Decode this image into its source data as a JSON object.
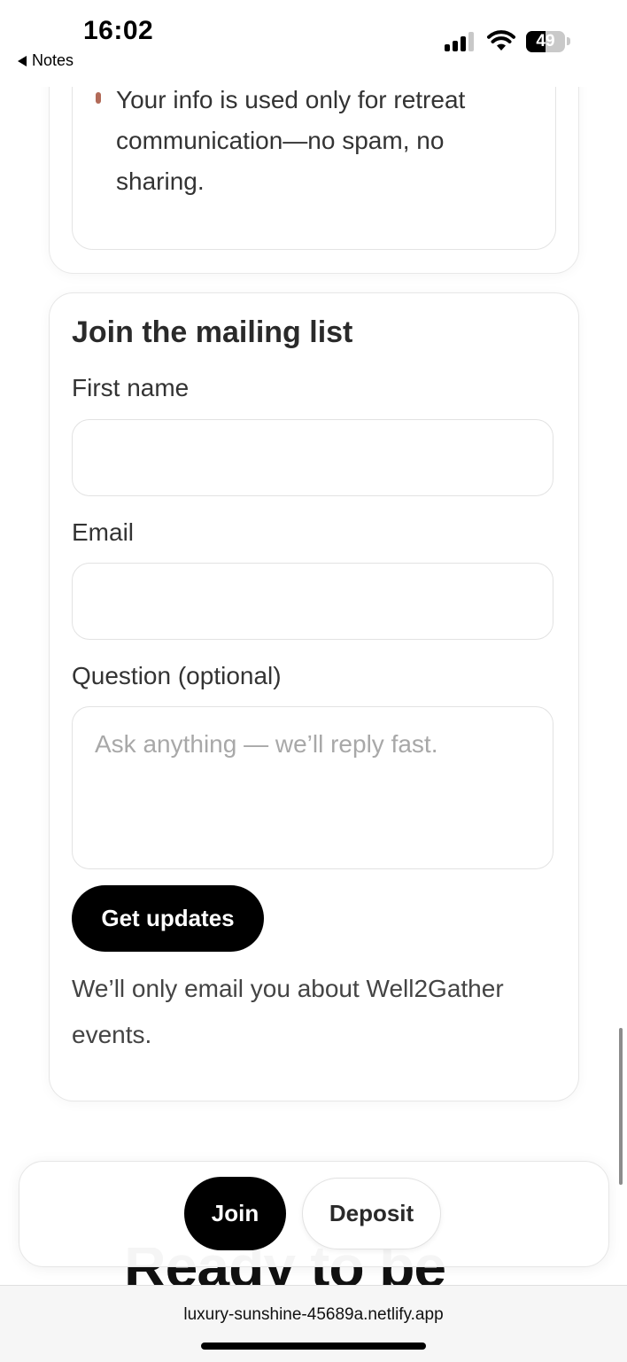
{
  "status_bar": {
    "time": "16:02",
    "back_label": "Notes",
    "battery_level": "49",
    "battery_fraction": 0.49,
    "icons": [
      "cellular-signal-icon",
      "wifi-icon",
      "battery-icon"
    ]
  },
  "privacy_note": {
    "bullet_text": "Your info is used only for retreat communication—no spam, no sharing.",
    "bullet_color": "#b26a58"
  },
  "mailing_list": {
    "title": "Join the mailing list",
    "first_name_label": "First name",
    "first_name_value": "",
    "email_label": "Email",
    "email_value": "",
    "question_label": "Question (optional)",
    "question_placeholder": "Ask anything — we’ll reply fast.",
    "submit_label": "Get updates",
    "disclaimer": "We’ll only email you about Well2Gather events."
  },
  "next_section": {
    "heading_partial": "Ready to be"
  },
  "floating_bar": {
    "join_label": "Join",
    "deposit_label": "Deposit"
  },
  "browser": {
    "url": "luxury-sunshine-45689a.netlify.app"
  },
  "colors": {
    "primary_button": "#000000",
    "accent": "#b26a58"
  }
}
